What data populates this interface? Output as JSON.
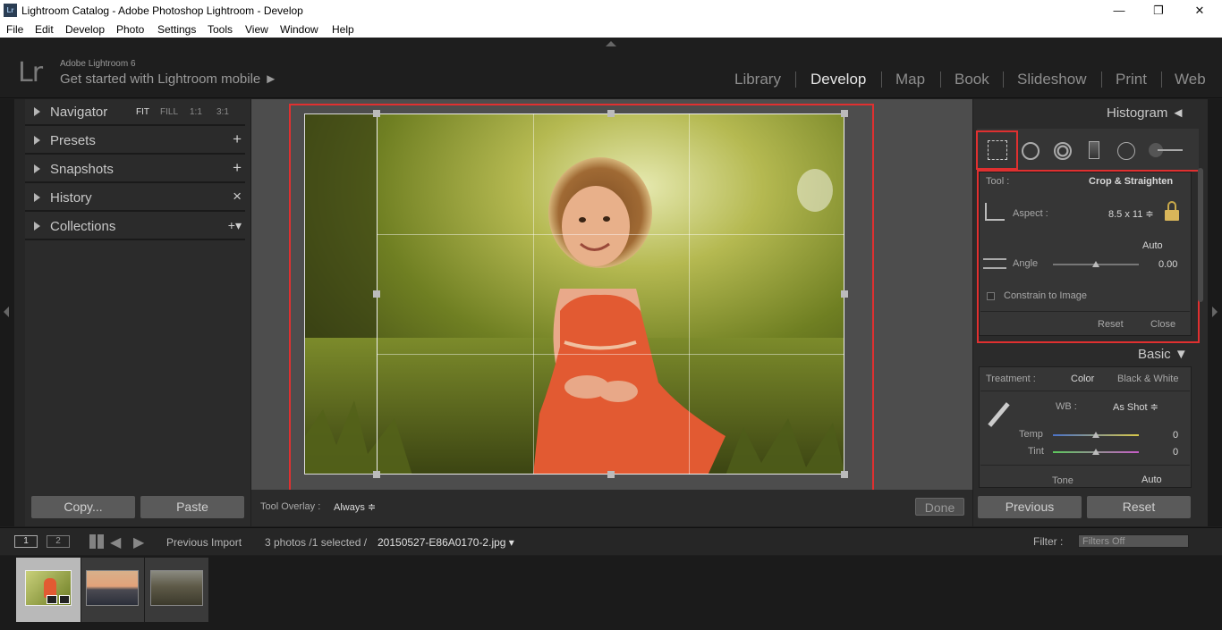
{
  "window": {
    "title": "Lightroom Catalog - Adobe Photoshop Lightroom - Develop",
    "app_icon": "Lr"
  },
  "menu": [
    "File",
    "Edit",
    "Develop",
    "Photo",
    "Settings",
    "Tools",
    "View",
    "Window",
    "Help"
  ],
  "identity": {
    "logo": "Lr",
    "version": "Adobe Lightroom 6",
    "tagline": "Get started with Lightroom mobile ►"
  },
  "modules": {
    "library": "Library",
    "develop": "Develop",
    "map": "Map",
    "book": "Book",
    "slideshow": "Slideshow",
    "print": "Print",
    "web": "Web"
  },
  "left_panel": {
    "navigator": "Navigator",
    "zoom": {
      "fit": "FIT",
      "fill": "FILL",
      "z11": "1:1",
      "z31": "3:1"
    },
    "presets": "Presets",
    "snapshots": "Snapshots",
    "history": "History",
    "collections": "Collections",
    "plus": "+",
    "close_x": "×",
    "collections_add": "+▾",
    "copy_label": "Copy...",
    "paste_label": "Paste"
  },
  "toolbar": {
    "overlay_label": "Tool Overlay :",
    "overlay_value": "Always ≑",
    "done_label": "Done"
  },
  "right_panel": {
    "histogram": "Histogram ◄",
    "crop": {
      "tool_label": "Tool :",
      "tool_value": "Crop & Straighten",
      "aspect_label": "Aspect :",
      "aspect_value": "8.5 x 11 ≑",
      "auto_label": "Auto",
      "angle_label": "Angle",
      "angle_value": "0.00",
      "angle_fraction": 0.5,
      "constrain_label": "Constrain to Image",
      "reset_label": "Reset",
      "close_label": "Close"
    },
    "basic": {
      "title": "Basic ▼",
      "treatment_label": "Treatment :",
      "color_label": "Color",
      "bw_label": "Black & White",
      "wb_label": "WB :",
      "wb_value": "As Shot ≑",
      "temp_label": "Temp",
      "temp_value": "0",
      "tint_label": "Tint",
      "tint_value": "0",
      "tone_label": "Tone",
      "tone_auto": "Auto"
    },
    "previous_label": "Previous",
    "reset_label": "Reset"
  },
  "filmstrip": {
    "monitor1": "1",
    "monitor2": "2",
    "source": "Previous Import",
    "count": "3 photos /1 selected /",
    "filename": "20150527-E86A0170-2.jpg ▾",
    "filter_label": "Filter :",
    "filter_value": "Filters Off"
  },
  "colors": {
    "accent_red": "#e03030",
    "panel": "#2b2b2b",
    "background": "#1f1f1f"
  }
}
